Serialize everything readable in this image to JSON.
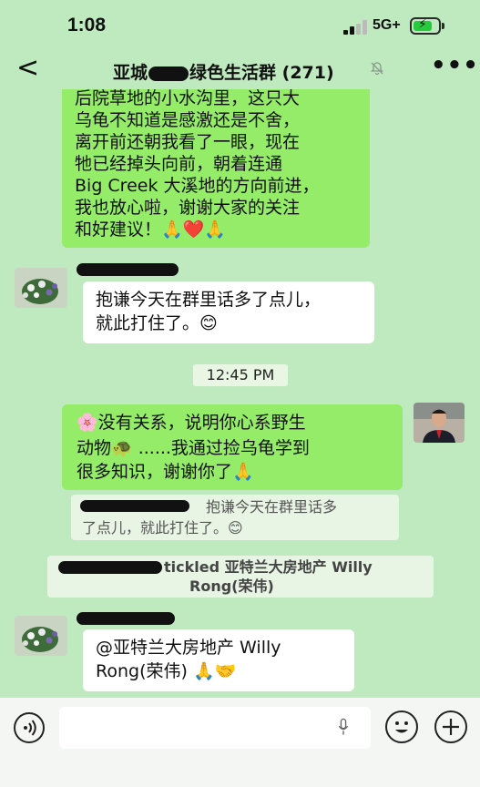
{
  "status_bar": {
    "time": "1:08",
    "network": "5G+"
  },
  "header": {
    "back_glyph": "<",
    "title_prefix": "亚城",
    "title_suffix": "绿色生活群 (271)",
    "mute_icon": "muted-bell-icon",
    "more_glyph": "•••"
  },
  "messages": {
    "m1": {
      "lines": [
        "后院草地的小水沟里，这只大",
        "乌龟不知道是感激还是不舍，",
        "离开前还朝我看了一眼，现在",
        "牠已经掉头向前，朝着连通",
        "Big Creek 大溪地的方向前进，",
        "我也放心啦，谢谢大家的关注",
        "和好建议！🙏❤️🙏"
      ]
    },
    "m2": {
      "lines": [
        "抱谦今天在群里话多了点儿，",
        "就此打住了。😊"
      ]
    },
    "timestamp": "12:45 PM",
    "m3": {
      "lines": [
        "🌸没有关系，说明你心系野生",
        "动物🐢 ......我通过捡乌龟学到",
        "很多知识，谢谢你了🙏"
      ]
    },
    "quote": {
      "lines": [
        "抱谦今天在群里话多",
        "了点儿，就此打住了。😊"
      ]
    },
    "tickle": {
      "lines": [
        "tickled 亚特兰大房地产 Willy",
        "Rong(荣伟)"
      ]
    },
    "m4": {
      "lines": [
        "@亚特兰大房地产 Willy",
        "Rong(荣伟) 🙏🤝"
      ]
    }
  },
  "colors": {
    "chat_bg": "#bfeabf",
    "self_bubble": "#95ec69",
    "other_bubble": "#ffffff"
  }
}
